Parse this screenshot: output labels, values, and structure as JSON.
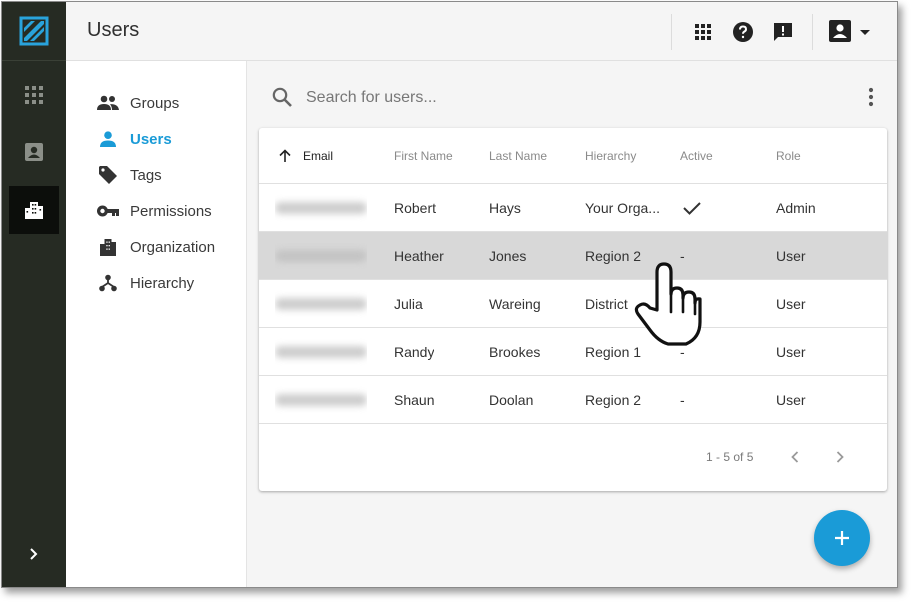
{
  "header": {
    "title": "Users"
  },
  "subnav": {
    "items": [
      {
        "label": "Groups",
        "icon": "groups-icon",
        "active": false
      },
      {
        "label": "Users",
        "icon": "person-icon",
        "active": true
      },
      {
        "label": "Tags",
        "icon": "tag-icon",
        "active": false
      },
      {
        "label": "Permissions",
        "icon": "key-icon",
        "active": false
      },
      {
        "label": "Organization",
        "icon": "building-icon",
        "active": false
      },
      {
        "label": "Hierarchy",
        "icon": "hierarchy-icon",
        "active": false
      }
    ]
  },
  "search": {
    "placeholder": "Search for users...",
    "value": ""
  },
  "table": {
    "columns": [
      "Email",
      "First Name",
      "Last Name",
      "Hierarchy",
      "Active",
      "Role"
    ],
    "sorted_column": "Email",
    "sort_direction": "ascending",
    "rows": [
      {
        "first": "Robert",
        "last": "Hays",
        "hierarchy": "Your Orga...",
        "active": true,
        "active_text": "",
        "role": "Admin"
      },
      {
        "first": "Heather",
        "last": "Jones",
        "hierarchy": "Region 2",
        "active": false,
        "active_text": "-",
        "role": "User"
      },
      {
        "first": "Julia",
        "last": "Wareing",
        "hierarchy": "District",
        "active": false,
        "active_text": "",
        "role": "User"
      },
      {
        "first": "Randy",
        "last": "Brookes",
        "hierarchy": "Region 1",
        "active": false,
        "active_text": "-",
        "role": "User"
      },
      {
        "first": "Shaun",
        "last": "Doolan",
        "hierarchy": "Region 2",
        "active": false,
        "active_text": "-",
        "role": "User"
      }
    ]
  },
  "pagination": {
    "range": "1 - 5 of 5"
  },
  "colors": {
    "accent": "#1a9bd7",
    "rail": "#262b23",
    "row_hover": "#d8d8d8"
  }
}
